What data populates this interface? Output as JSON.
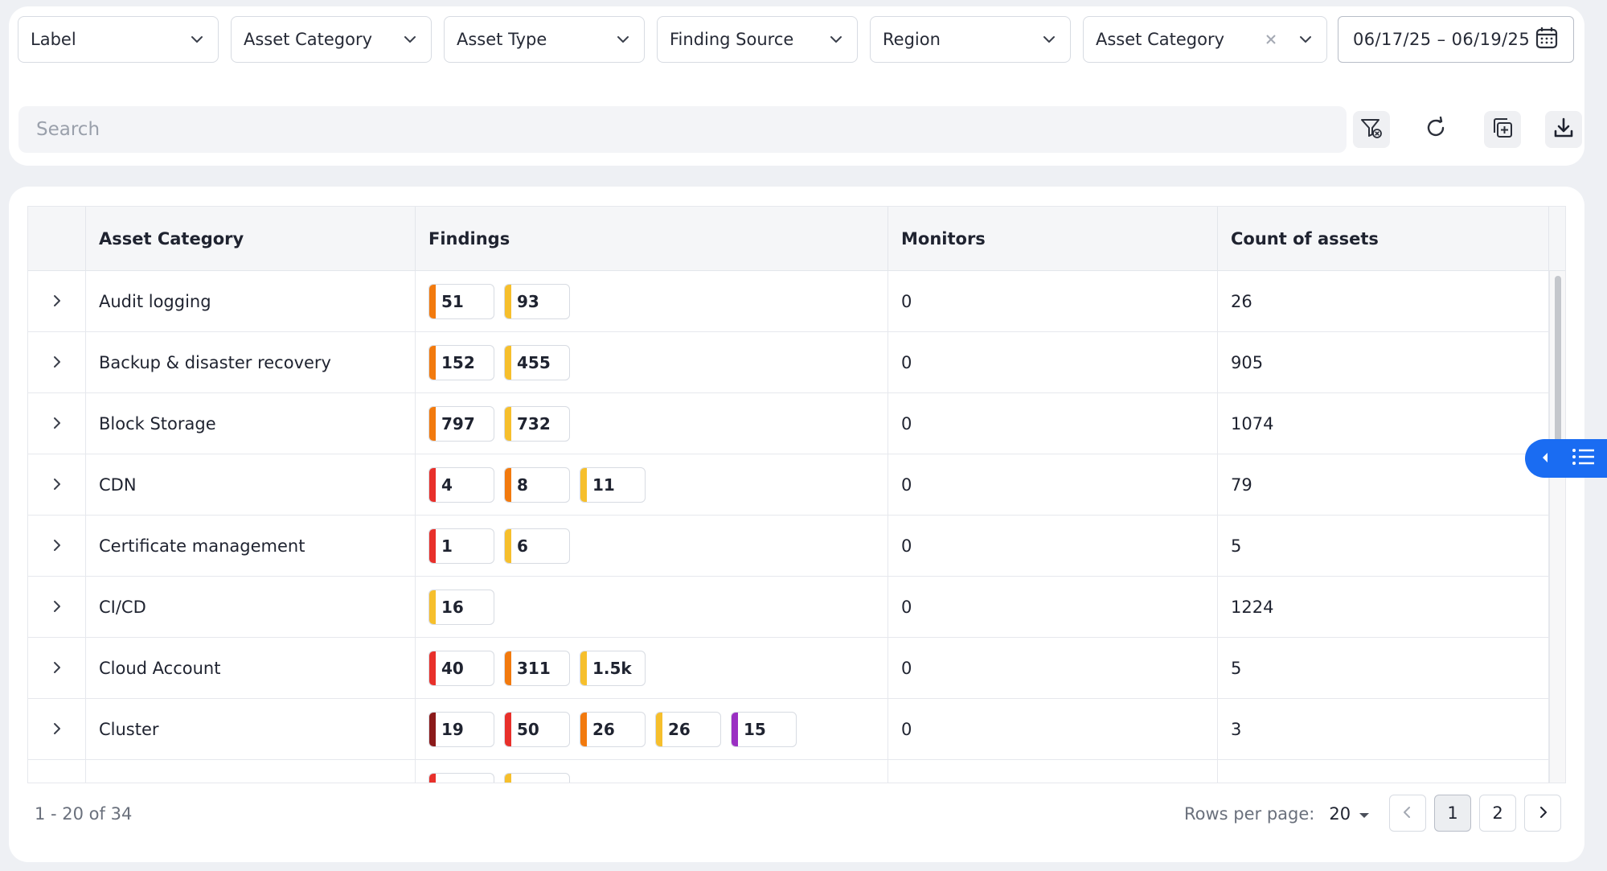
{
  "filters": {
    "dropdowns": [
      {
        "label": "Label"
      },
      {
        "label": "Asset Category"
      },
      {
        "label": "Asset Type"
      },
      {
        "label": "Finding Source"
      },
      {
        "label": "Region"
      },
      {
        "label": "Asset Category",
        "has_clear": true
      }
    ],
    "date_range": "06/17/25 – 06/19/25",
    "search_placeholder": "Search"
  },
  "toolbar_icons": [
    "clear-filter-icon",
    "refresh-icon",
    "add-copy-icon",
    "download-icon"
  ],
  "table": {
    "columns": [
      "Asset Category",
      "Findings",
      "Monitors",
      "Count of assets"
    ],
    "severity_colors": {
      "critical": "#8b1a1a",
      "high": "#e8302b",
      "medium": "#f27a0e",
      "low": "#f6bf2c",
      "info": "#9a2fc2"
    },
    "rows": [
      {
        "category": "Audit logging",
        "findings": [
          {
            "value": "51",
            "severity": "medium"
          },
          {
            "value": "93",
            "severity": "low"
          }
        ],
        "monitors": "0",
        "count": "26"
      },
      {
        "category": "Backup & disaster recovery",
        "findings": [
          {
            "value": "152",
            "severity": "medium"
          },
          {
            "value": "455",
            "severity": "low"
          }
        ],
        "monitors": "0",
        "count": "905"
      },
      {
        "category": "Block Storage",
        "findings": [
          {
            "value": "797",
            "severity": "medium"
          },
          {
            "value": "732",
            "severity": "low"
          }
        ],
        "monitors": "0",
        "count": "1074"
      },
      {
        "category": "CDN",
        "findings": [
          {
            "value": "4",
            "severity": "high"
          },
          {
            "value": "8",
            "severity": "medium"
          },
          {
            "value": "11",
            "severity": "low"
          }
        ],
        "monitors": "0",
        "count": "79"
      },
      {
        "category": "Certificate management",
        "findings": [
          {
            "value": "1",
            "severity": "high"
          },
          {
            "value": "6",
            "severity": "low"
          }
        ],
        "monitors": "0",
        "count": "5"
      },
      {
        "category": "CI/CD",
        "findings": [
          {
            "value": "16",
            "severity": "low"
          }
        ],
        "monitors": "0",
        "count": "1224"
      },
      {
        "category": "Cloud Account",
        "findings": [
          {
            "value": "40",
            "severity": "high"
          },
          {
            "value": "311",
            "severity": "medium"
          },
          {
            "value": "1.5k",
            "severity": "low"
          }
        ],
        "monitors": "0",
        "count": "5"
      },
      {
        "category": "Cluster",
        "findings": [
          {
            "value": "19",
            "severity": "critical"
          },
          {
            "value": "50",
            "severity": "high"
          },
          {
            "value": "26",
            "severity": "medium"
          },
          {
            "value": "26",
            "severity": "low"
          },
          {
            "value": "15",
            "severity": "info"
          }
        ],
        "monitors": "0",
        "count": "3"
      },
      {
        "category": "",
        "findings": [
          {
            "value": "",
            "severity": "high"
          },
          {
            "value": "",
            "severity": "low"
          }
        ],
        "monitors": "",
        "count": ""
      }
    ]
  },
  "pagination": {
    "range_text": "1 - 20 of 34",
    "rows_per_page_label": "Rows per page:",
    "rows_per_page_value": "20",
    "pages": [
      "1",
      "2"
    ],
    "current_page": "1"
  }
}
